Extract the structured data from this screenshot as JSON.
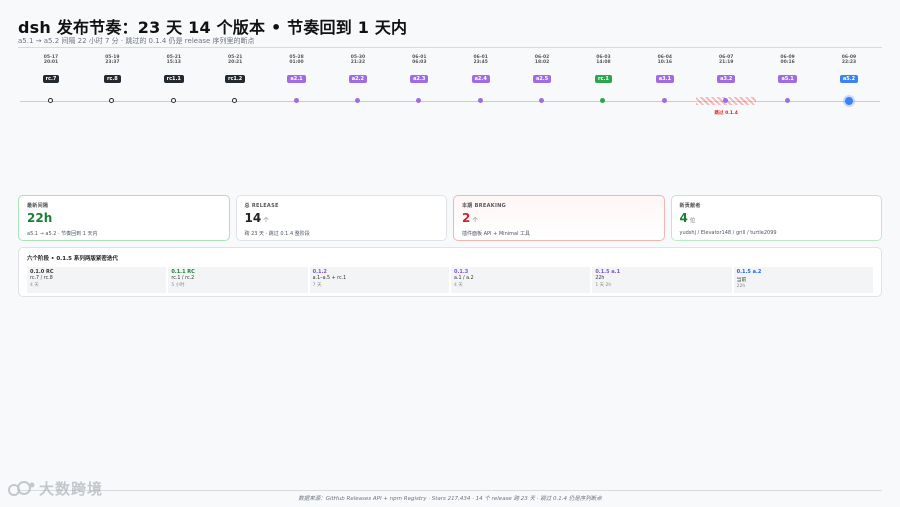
{
  "header": {
    "title": "dsh 发布节奏：23 天 14 个版本 • 节奏回到 1 天内",
    "subtitle": "a5.1 → a5.2 间隔 22 小时 7 分 · 跳过的 0.1.4 仍是 release 序列里的断点"
  },
  "timeline": {
    "events": [
      {
        "date": "05-17\n20:01",
        "tag": "rc.7",
        "kind": "rc"
      },
      {
        "date": "05-19\n23:37",
        "tag": "rc.8",
        "kind": "rc"
      },
      {
        "date": "05-21\n15:13",
        "tag": "rc1.1",
        "kind": "rc"
      },
      {
        "date": "05-21\n20:21",
        "tag": "rc1.2",
        "kind": "rc"
      },
      {
        "date": "05-28\n01:00",
        "tag": "a2.1",
        "kind": "a"
      },
      {
        "date": "05-30\n21:32",
        "tag": "a2.2",
        "kind": "a"
      },
      {
        "date": "06-01\n06:03",
        "tag": "a2.3",
        "kind": "a"
      },
      {
        "date": "06-01\n23:45",
        "tag": "a2.4",
        "kind": "a"
      },
      {
        "date": "06-02\n18:02",
        "tag": "a2.5",
        "kind": "a"
      },
      {
        "date": "06-03\n14:08",
        "tag": "rc.1",
        "kind": "green"
      },
      {
        "date": "06-04\n10:16",
        "tag": "a3.1",
        "kind": "a"
      },
      {
        "date": "06-07\n21:19",
        "tag": "a3.2",
        "kind": "skip"
      },
      {
        "date": "06-09\n00:16",
        "tag": "a5.1",
        "kind": "a"
      },
      {
        "date": "06-09\n22:23",
        "tag": "a5.2",
        "kind": "last"
      }
    ],
    "skip_note": "跳过 0.1.4"
  },
  "cards": [
    {
      "label": "最新间隔",
      "value": "22h",
      "unit": "",
      "desc": "a5.1 → a5.2 · 节奏回到 1 天内"
    },
    {
      "label": "总 RELEASE",
      "value": "14",
      "unit": "个",
      "desc": "跨 23 天 · 跳过 0.1.4 整阶段"
    },
    {
      "label": "本期 BREAKING",
      "value": "2",
      "unit": "个",
      "desc": "插件面板 API + Minimal 工具"
    },
    {
      "label": "新贡献者",
      "value": "4",
      "unit": "位",
      "desc": "yudshj / Elevator148 / grill / turtle2099"
    }
  ],
  "phases": {
    "title": "六个阶段 • 0.1.5 系列两版紧密迭代",
    "items": [
      {
        "name": "0.1.0 RC",
        "range": "rc.7 / rc.8",
        "duration": "4 天",
        "color": "dark"
      },
      {
        "name": "0.1.1 RC",
        "range": "rc.1 / rc.2",
        "duration": "5 小时",
        "color": "green"
      },
      {
        "name": "0.1.2",
        "range": "a.1–a.5 + rc.1",
        "duration": "7 天",
        "color": "purple"
      },
      {
        "name": "0.1.3",
        "range": "a.1 / a.2",
        "duration": "4 天",
        "color": "purple"
      },
      {
        "name": "0.1.5 a.1",
        "range": "22h",
        "duration": "1 天 2h",
        "color": "purple"
      },
      {
        "name": "0.1.5 a.2",
        "range": "当前",
        "duration": "22h",
        "color": "blue"
      }
    ]
  },
  "footer": "数据来源：GitHub Releases API + npm Registry · Stars 217,434 · 14 个 release 跨 23 天 · 跳过 0.1.4 仍是序列断点",
  "watermark": "大数跨境"
}
